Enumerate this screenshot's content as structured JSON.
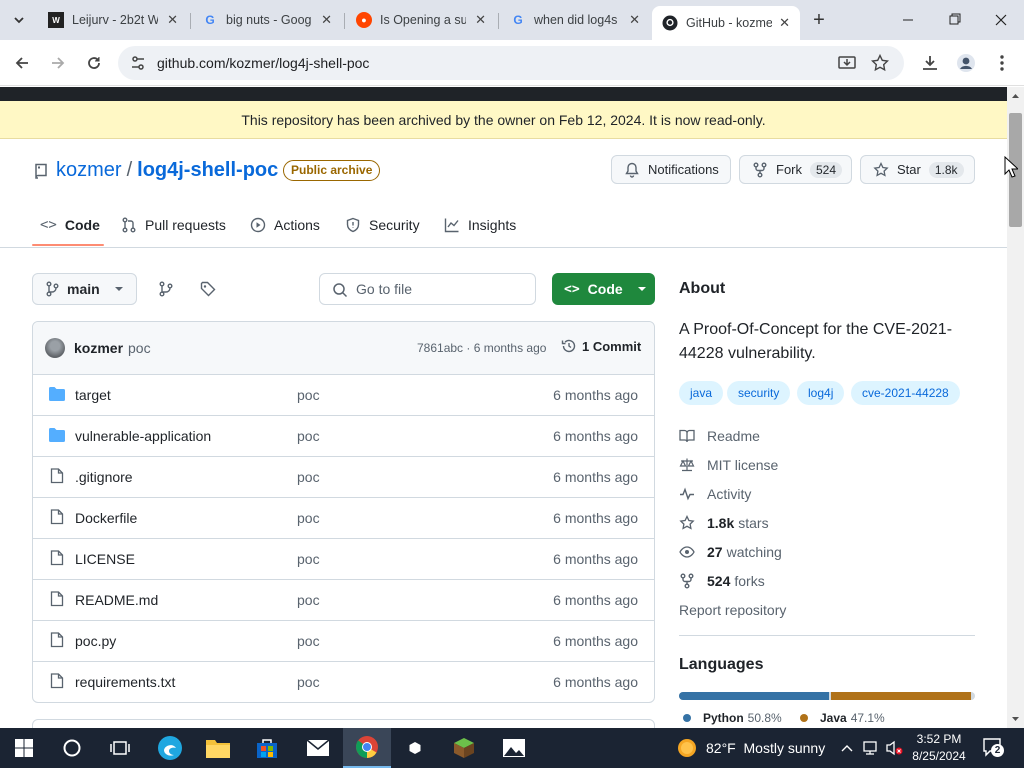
{
  "browser": {
    "tabs": [
      {
        "title": "Leijurv - 2b2t W",
        "icon": "wiki-icon"
      },
      {
        "title": "big nuts - Goog",
        "icon": "google-icon"
      },
      {
        "title": "Is Opening a su",
        "icon": "reddit-icon"
      },
      {
        "title": "when did log4s",
        "icon": "google-icon"
      },
      {
        "title": "GitHub - kozme",
        "icon": "github-icon"
      }
    ],
    "new_tab": "+",
    "url": "github.com/kozmer/log4j-shell-poc"
  },
  "banner": "This repository has been archived by the owner on Feb 12, 2024. It is now read-only.",
  "repo": {
    "owner": "kozmer",
    "sep": "/",
    "name": "log4j-shell-poc",
    "badge": "Public archive",
    "notifications": "Notifications",
    "fork_label": "Fork",
    "fork_count": "524",
    "star_label": "Star",
    "star_count": "1.8k"
  },
  "nav": {
    "code": "Code",
    "pulls": "Pull requests",
    "actions": "Actions",
    "security": "Security",
    "insights": "Insights"
  },
  "filebar": {
    "branch": "main",
    "search_placeholder": "Go to file",
    "code_button": "Code"
  },
  "commit": {
    "author": "kozmer",
    "message": "poc",
    "hash_time": "7861abc · 6 months ago",
    "commits": "1 Commit"
  },
  "files": [
    {
      "name": "target",
      "type": "dir",
      "msg": "poc",
      "date": "6 months ago"
    },
    {
      "name": "vulnerable-application",
      "type": "dir",
      "msg": "poc",
      "date": "6 months ago"
    },
    {
      "name": ".gitignore",
      "type": "file",
      "msg": "poc",
      "date": "6 months ago"
    },
    {
      "name": "Dockerfile",
      "type": "file",
      "msg": "poc",
      "date": "6 months ago"
    },
    {
      "name": "LICENSE",
      "type": "file",
      "msg": "poc",
      "date": "6 months ago"
    },
    {
      "name": "README.md",
      "type": "file",
      "msg": "poc",
      "date": "6 months ago"
    },
    {
      "name": "poc.py",
      "type": "file",
      "msg": "poc",
      "date": "6 months ago"
    },
    {
      "name": "requirements.txt",
      "type": "file",
      "msg": "poc",
      "date": "6 months ago"
    }
  ],
  "about": {
    "heading": "About",
    "description": "A Proof-Of-Concept for the CVE-2021-44228 vulnerability.",
    "topics": [
      "java",
      "security",
      "log4j",
      "cve-2021-44228"
    ],
    "readme": "Readme",
    "license": "MIT license",
    "activity": "Activity",
    "stars_count": "1.8k",
    "stars_label": "stars",
    "watching_count": "27",
    "watching_label": "watching",
    "forks_count": "524",
    "forks_label": "forks",
    "report": "Report repository"
  },
  "languages": {
    "heading": "Languages",
    "items": [
      {
        "name": "Python",
        "pct": "50.8%",
        "color": "#3572A5",
        "share": 50.8
      },
      {
        "name": "Java",
        "pct": "47.1%",
        "color": "#b07219",
        "share": 47.1
      }
    ]
  },
  "taskbar": {
    "weather": "82°F  Mostly sunny",
    "time": "3:52 PM",
    "date": "8/25/2024",
    "notifications": "2"
  }
}
